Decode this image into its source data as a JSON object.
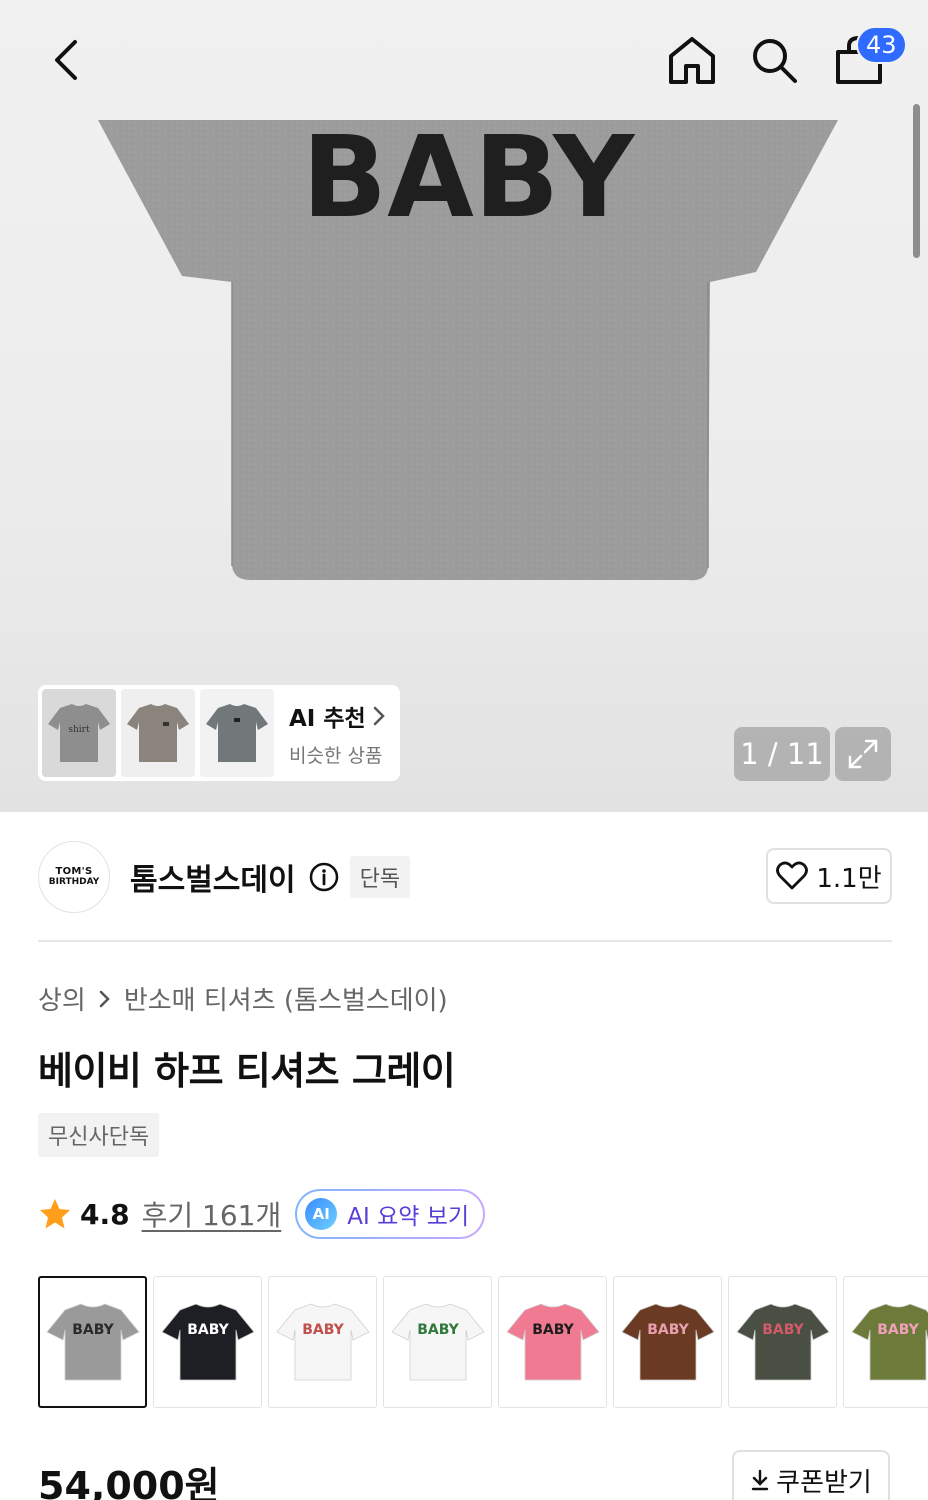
{
  "header": {
    "cart_count": "43"
  },
  "hero": {
    "print_text": "BABY",
    "counter": "1 / 11"
  },
  "ai_recommend": {
    "title": "AI 추천",
    "subtitle": "비슷한 상품",
    "thumb1_text": "shirt"
  },
  "brand": {
    "logo_line1": "TOM'S",
    "logo_line2": "BIRTHDAY",
    "name": "톰스벌스데이",
    "tag": "단독",
    "likes": "1.1만"
  },
  "product": {
    "breadcrumb": [
      "상의",
      "반소매 티셔츠 (톰스벌스데이)"
    ],
    "title": "베이비 하프 티셔츠 그레이",
    "exclusive_tag": "무신사단독",
    "rating": "4.8",
    "reviews": "후기 161개",
    "ai_summary_icon": "AI",
    "ai_summary": "AI 요약 보기",
    "price": "54,000원",
    "coupon": "쿠폰받기"
  },
  "swatches": [
    {
      "color": "#9a9a9a",
      "text_color": "#2a2a2a",
      "label": "BABY"
    },
    {
      "color": "#1d1f24",
      "text_color": "#ffffff",
      "label": "BABY"
    },
    {
      "color": "#f6f6f6",
      "text_color": "#c0504d",
      "label": "BABY"
    },
    {
      "color": "#f6f6f6",
      "text_color": "#2f7a3a",
      "label": "BABY"
    },
    {
      "color": "#ef7a92",
      "text_color": "#1d1d1d",
      "label": "BABY"
    },
    {
      "color": "#6b3a22",
      "text_color": "#e8a0b0",
      "label": "BABY"
    },
    {
      "color": "#4a4f44",
      "text_color": "#d45a6a",
      "label": "BABY"
    },
    {
      "color": "#6c7a3a",
      "text_color": "#f0a0b8",
      "label": "BABY"
    }
  ],
  "colors": {
    "accent_blue": "#2f6bff",
    "ai_purple": "#5a3fd6",
    "star": "#ff9f1a"
  }
}
